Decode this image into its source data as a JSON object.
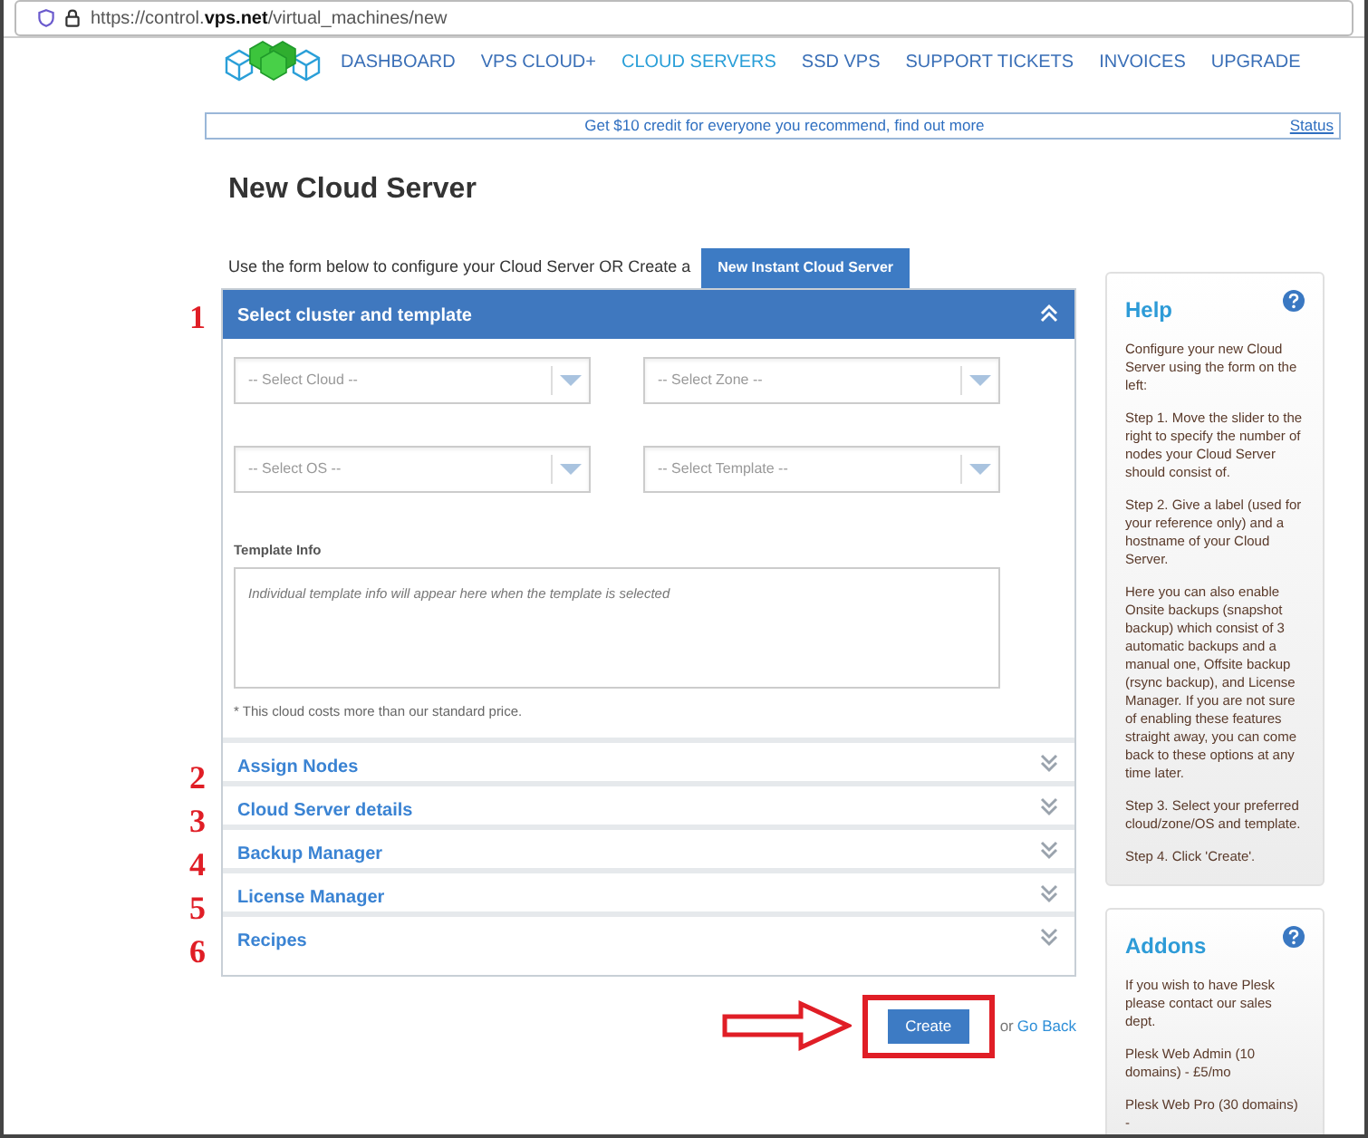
{
  "browser": {
    "url_prefix": "https://control.",
    "url_domain": "vps.net",
    "url_path": "/virtual_machines/new"
  },
  "nav": [
    {
      "label": "DASHBOARD",
      "selected": false
    },
    {
      "label": "VPS CLOUD+",
      "selected": false
    },
    {
      "label": "CLOUD SERVERS",
      "selected": true
    },
    {
      "label": "SSD VPS",
      "selected": false
    },
    {
      "label": "SUPPORT TICKETS",
      "selected": false
    },
    {
      "label": "INVOICES",
      "selected": false
    },
    {
      "label": "UPGRADE",
      "selected": false
    }
  ],
  "banner": {
    "text": "Get $10 credit for everyone you recommend, find out more",
    "link": "Status"
  },
  "title": "New Cloud Server",
  "intro": {
    "text": "Use the form below to configure your Cloud Server OR Create a",
    "button": "New Instant Cloud Server"
  },
  "sections": [
    {
      "number": "1",
      "title": "Select cluster and template",
      "expanded": true
    },
    {
      "number": "2",
      "title": "Assign Nodes",
      "expanded": false
    },
    {
      "number": "3",
      "title": "Cloud Server details",
      "expanded": false
    },
    {
      "number": "4",
      "title": "Backup Manager",
      "expanded": false
    },
    {
      "number": "5",
      "title": "License Manager",
      "expanded": false
    },
    {
      "number": "6",
      "title": "Recipes",
      "expanded": false
    }
  ],
  "selects": [
    {
      "placeholder": "-- Select Cloud --"
    },
    {
      "placeholder": "-- Select Zone --"
    },
    {
      "placeholder": "-- Select OS --"
    },
    {
      "placeholder": "-- Select Template --"
    }
  ],
  "template_info": {
    "label": "Template Info",
    "placeholder": "Individual template info will appear here when the template is selected"
  },
  "note": "* This cloud costs more than our standard price.",
  "actions": {
    "create": "Create",
    "or": "or",
    "back": "Go Back"
  },
  "help": {
    "title": "Help",
    "paragraphs": [
      "Configure your new Cloud Server using the form on the left:",
      "Step 1. Move the slider to the right to specify the number of nodes your Cloud Server should consist of.",
      "Step 2. Give a label (used for your reference only) and a hostname of your Cloud Server.",
      "Here you can also enable Onsite backups (snapshot backup) which consist of 3 automatic backups and a manual one, Offsite backup (rsync backup), and License Manager. If you are not sure of enabling these features straight away, you can come back to these options at any time later.",
      "Step 3. Select your preferred cloud/zone/OS and template.",
      "Step 4. Click 'Create'."
    ]
  },
  "addons": {
    "title": "Addons",
    "paragraphs": [
      "If you wish to have Plesk please contact our sales dept.",
      "Plesk Web Admin (10 domains) - £5/mo",
      "Plesk Web Pro (30 domains) -"
    ]
  }
}
